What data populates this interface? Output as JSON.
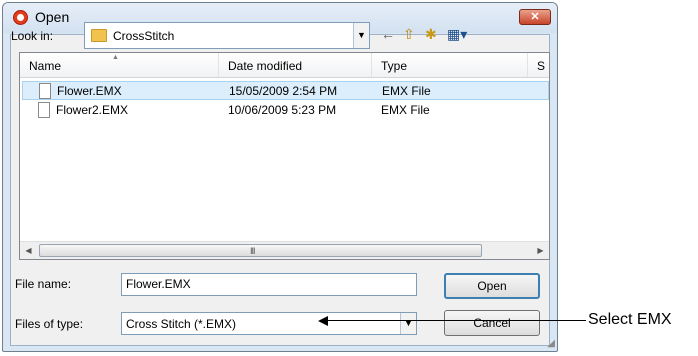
{
  "window": {
    "title": "Open",
    "close_glyph": "✕"
  },
  "lookin": {
    "label": "Look in:",
    "value": "CrossStitch"
  },
  "toolbar": {
    "back_icon": "←",
    "up_folder_icon": "⇧",
    "new_folder_icon": "✱",
    "view_menu_icon": "▦▾"
  },
  "list": {
    "columns": [
      "Name",
      "Date modified",
      "Type",
      "S"
    ],
    "rows": [
      {
        "name": "Flower.EMX",
        "date": "15/05/2009 2:54 PM",
        "type": "EMX File",
        "selected": true
      },
      {
        "name": "Flower2.EMX",
        "date": "10/06/2009 5:23 PM",
        "type": "EMX File",
        "selected": false
      }
    ],
    "scroll_grip": "III"
  },
  "filename": {
    "label": "File name:",
    "value": "Flower.EMX"
  },
  "filetype": {
    "label": "Files of type:",
    "value": "Cross Stitch (*.EMX)"
  },
  "buttons": {
    "open": "Open",
    "cancel": "Cancel"
  },
  "annotation": {
    "text": "Select EMX"
  }
}
